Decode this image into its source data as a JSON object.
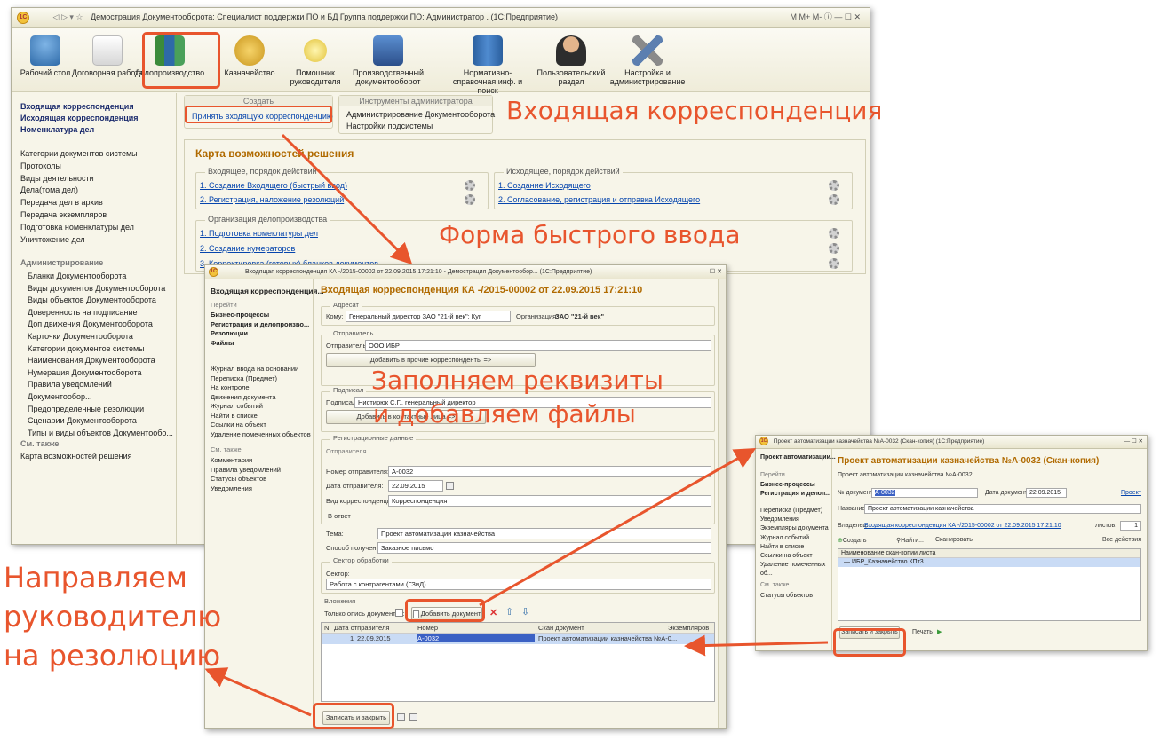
{
  "colors": {
    "accent": "#e8552d",
    "link": "#0645ad",
    "heading": "#b06a00",
    "win_bg": "#f7f5e9",
    "selected_row": "#c9dbf5"
  },
  "main_window": {
    "title": "Демострация Документооборота: Специалист поддержки ПО и БД Группа поддержки ПО: Администратор . (1С:Предприятие)",
    "toolbar_right": "M  M+  M-",
    "sections": [
      {
        "label": "Рабочий стол",
        "icon": "desk-lamp-icon"
      },
      {
        "label": "Договорная работа",
        "icon": "contract-icon"
      },
      {
        "label": "Делопроизводство",
        "icon": "binders-icon"
      },
      {
        "label": "Казначейство",
        "icon": "coins-icon"
      },
      {
        "label": "Помощник руководителя",
        "icon": "bulb-icon"
      },
      {
        "label": "Производственный документооборот",
        "icon": "pc-icon"
      },
      {
        "label": "Нормативно-справочная инф. и поиск",
        "icon": "books-icon"
      },
      {
        "label": "Пользовательский раздел",
        "icon": "user-icon"
      },
      {
        "label": "Настройка и администрирование",
        "icon": "tools-icon"
      }
    ],
    "nav_bold": [
      "Входящая корреспонденция",
      "Исходящая корреспонденция",
      "Номенклатура дел"
    ],
    "nav_list": [
      "Категории документов системы",
      "Протоколы",
      "Виды деятельности",
      "Дела(тома дел)",
      "Передача дел в архив",
      "Передача экземпляров",
      "Подготовка номенклатуры дел",
      "Уничтожение дел"
    ],
    "admin_header": "Администрирование",
    "admin_list": [
      "Бланки Документооборота",
      "Виды документов Документооборота",
      "Виды объектов Документооборота",
      "Доверенность на подписание",
      "Доп движения Документооборота",
      "Карточки Документооборота",
      "Категории документов системы",
      "Наименования Документооборота",
      "Нумерация Документооборота",
      "Правила уведомлений Документообор...",
      "Предопределенные резолюции",
      "Сценарии Документооборота",
      "Типы и виды объектов Документообо..."
    ],
    "see_also_header": "См. также",
    "see_also_item": "Карта возможностей решения",
    "create_header": "Создать",
    "create_item": "Принять входящую корреспонденцию",
    "admin_tools_header": "Инструменты администратора",
    "admin_tools": [
      "Администрирование Документооборота",
      "Настройки подсистемы"
    ],
    "map_title": "Карта возможностей решения",
    "incoming_group": "Входящее, порядок действий",
    "incoming_links": [
      "1. Создание Входящего (быстрый ввод)",
      "2. Регистрация, наложение резолюций"
    ],
    "outgoing_group": "Исходящее, порядок действий",
    "outgoing_links": [
      "1. Создание Исходящего",
      "2. Согласование, регистрация и отправка Исходящего"
    ],
    "org_group": "Организация делопроизводства",
    "org_links": [
      "1. Подготовка номеклатуры дел",
      "2. Создание нумераторов",
      "3. Корректировка (готовых) бланков документов"
    ]
  },
  "form_window": {
    "title": "Входящая корреспонденция  КА  -/2015-00002 от 22.09.2015 17:21:10 - Демострация Документообор... (1С:Предприятие)",
    "nav_title": "Входящая корреспонденция...",
    "goto": "Перейти",
    "nav_bold": [
      "Бизнес-процессы",
      "Регистрация и делопроизво...",
      "Резолюции",
      "Файлы"
    ],
    "nav_list": [
      "Журнал ввода на основании",
      "Переписка (Предмет)",
      "На контроле",
      "Движения документа",
      "Журнал событий",
      "Найти в списке",
      "Ссылки на объект",
      "Удаление помеченных объектов"
    ],
    "see_also": "См. также",
    "see_also_list": [
      "Комментарии",
      "Правила уведомлений",
      "Статусы объектов",
      "Уведомления"
    ],
    "heading": "Входящая корреспонденция  КА   -/2015-00002 от 22.09.2015 17:21:10",
    "addressee": "Адресат",
    "to_label": "Кому:",
    "to_value": "Генеральный директор ЗАО \"21-й век\": Куг",
    "org_label": "Организация:",
    "org_value": "ЗАО \"21-й век\"",
    "sender": "Отправитель",
    "sender_label": "Отправитель:",
    "sender_value": "ООО ИБР",
    "add_corr": "Добавить в прочие корреспонденты =>",
    "signed": "Подписал",
    "signed_label": "Подписал:",
    "signed_value": "Нистирюк С.Г., генеральный директор",
    "add_contact": "Добавить в контактные лица =>",
    "reg_data": "Регистрационные данные",
    "reg_sender": "Отправителя",
    "num_label": "Номер отправителя:",
    "num_value": "А-0032",
    "date_label": "Дата отправителя:",
    "date_value": "22.09.2015",
    "kind_label": "Вид корреспонденции:",
    "kind_value": "Корреспонденция",
    "reply": "В ответ",
    "topic_label": "Тема:",
    "topic_value": "Проект автоматизации казначейства",
    "method_label": "Способ получения:",
    "method_value": "Заказное письмо",
    "sector": "Сектор обработки",
    "sector_label": "Сектор:",
    "sector_value": "Работа с контрагентами (ГЗиД)",
    "attachments": "Вложения",
    "only_inventory": "Только опись документов:",
    "add_doc": "Добавить документ",
    "cols": [
      "N",
      "Дата отправителя",
      "Номер",
      "Скан документ",
      "Экземпляров"
    ],
    "row": [
      "1",
      "22.09.2015",
      "А-0032",
      "Проект автоматизации казначейства №А-0..."
    ],
    "save_close": "Записать и закрыть"
  },
  "scan_window": {
    "title": "Проект автоматизации казначейства №А-0032 (Скан-копия) (1С:Предприятие)",
    "nav_title": "Проект автоматизации...",
    "goto": "Перейти",
    "nav_bold": [
      "Бизнес-процессы",
      "Регистрация и делоп..."
    ],
    "nav_list": [
      "Переписка (Предмет)",
      "Уведомления",
      "Экземпляры документа",
      "Журнал событий",
      "Найти в списке",
      "Ссылки на объект",
      "Удаление помеченных об..."
    ],
    "see_also": "См. также",
    "see_also_item": "Статусы объектов",
    "heading": "Проект автоматизации казначейства №А-0032 (Скан-копия)",
    "subheading": "Проект автоматизации казначейства №А-0032",
    "docnum_label": "№ документа:",
    "docnum_value": "А-0032",
    "docdate_label": "Дата документа:",
    "docdate_value": "22.09.2015",
    "project_link": "Проект",
    "name_label": "Название:",
    "name_value": "Проект автоматизации казначейства",
    "owner_label": "Владелец:",
    "owner_value": "Входящая корреспонденция  КА  -/2015-00002 от 22.09.2015 17:21:10",
    "sheets_label": "листов:",
    "sheets_value": "1",
    "create": "Создать",
    "find": "Найти...",
    "scan": "Сканировать",
    "all_actions": "Все действия",
    "list_header": "Наименование скан-копии листа",
    "list_item": "ИБР_Казначейство КПт3",
    "save_close": "Записать и закрыть",
    "print": "Печать"
  },
  "annotations": {
    "incoming": "Входящая корреспонденция",
    "quick_form": "Форма быстрого ввода",
    "fill_line1": "Заполняем реквизиты",
    "fill_line2": "и добавляем файлы",
    "direct_line1": "Направляем",
    "direct_line2": "руководителю",
    "direct_line3": "на резолюцию"
  }
}
